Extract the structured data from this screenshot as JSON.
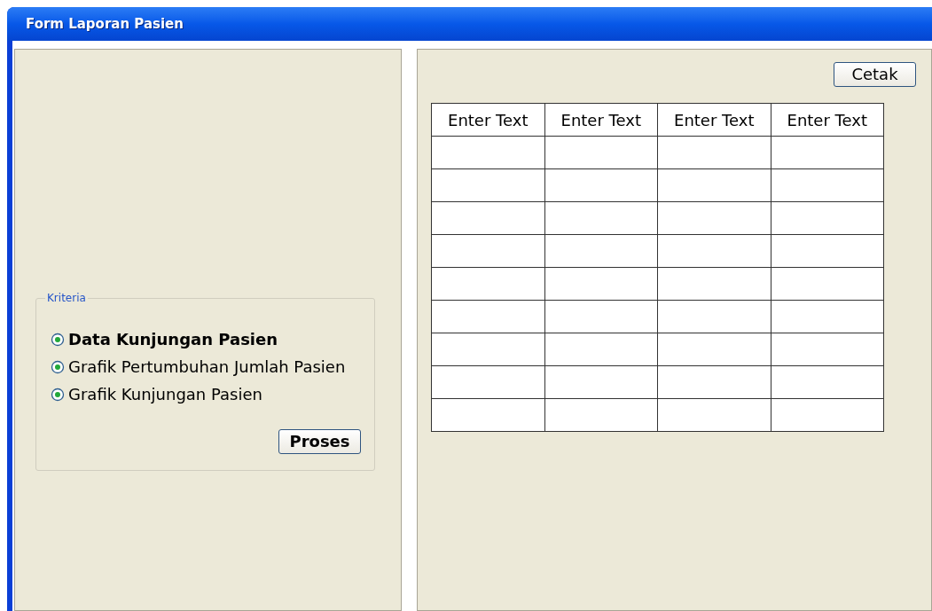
{
  "window": {
    "title": "Form Laporan Pasien"
  },
  "kriteria": {
    "legend": "Kriteria",
    "options": [
      {
        "label": "Data Kunjungan Pasien",
        "selected": true,
        "bold": true
      },
      {
        "label": "Grafik Pertumbuhan Jumlah Pasien",
        "selected": true,
        "bold": false
      },
      {
        "label": "Grafik Kunjungan Pasien",
        "selected": true,
        "bold": false
      }
    ],
    "button": "Proses"
  },
  "print_button": "Cetak",
  "table": {
    "columns": [
      "Enter Text",
      "Enter Text",
      "Enter Text",
      "Enter Text"
    ],
    "rows": [
      {
        "kind": "empty"
      },
      {
        "kind": "empty"
      },
      {
        "kind": "empty"
      },
      {
        "kind": "empty"
      },
      {
        "kind": "empty"
      },
      {
        "kind": "empty"
      },
      {
        "kind": "empty"
      },
      {
        "kind": "empty"
      },
      {
        "kind": "empty"
      }
    ]
  }
}
